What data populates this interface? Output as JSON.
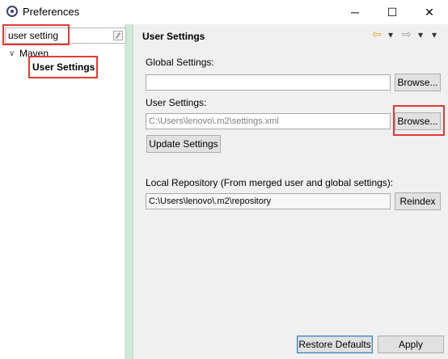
{
  "window": {
    "title": "Preferences",
    "minimize_glyph": "─",
    "maximize_glyph": "☐",
    "close_glyph": "✕"
  },
  "sidebar": {
    "filter_value": "user setting",
    "tree": {
      "parent_label": "Maven",
      "child_label": "User Settings"
    }
  },
  "page": {
    "title": "User Settings",
    "nav": {
      "back_glyph": "⇦",
      "forward_glyph": "⇨",
      "dropdown_glyph": "▾",
      "menu_glyph": "▾"
    },
    "global_settings_label": "Global Settings:",
    "global_settings_value": "",
    "user_settings_label": "User Settings:",
    "user_settings_value": "C:\\Users\\lenovo\\.m2\\settings.xml",
    "browse_label": "Browse...",
    "update_settings_label": "Update Settings",
    "local_repo_label": "Local Repository (From merged user and global settings):",
    "local_repo_value": "C:\\Users\\lenovo\\.m2\\repository",
    "reindex_label": "Reindex"
  },
  "footer": {
    "restore_defaults_label": "Restore Defaults",
    "apply_label": "Apply"
  },
  "colors": {
    "highlight_box": "#e53935",
    "accent_icon": "#e8a317"
  }
}
